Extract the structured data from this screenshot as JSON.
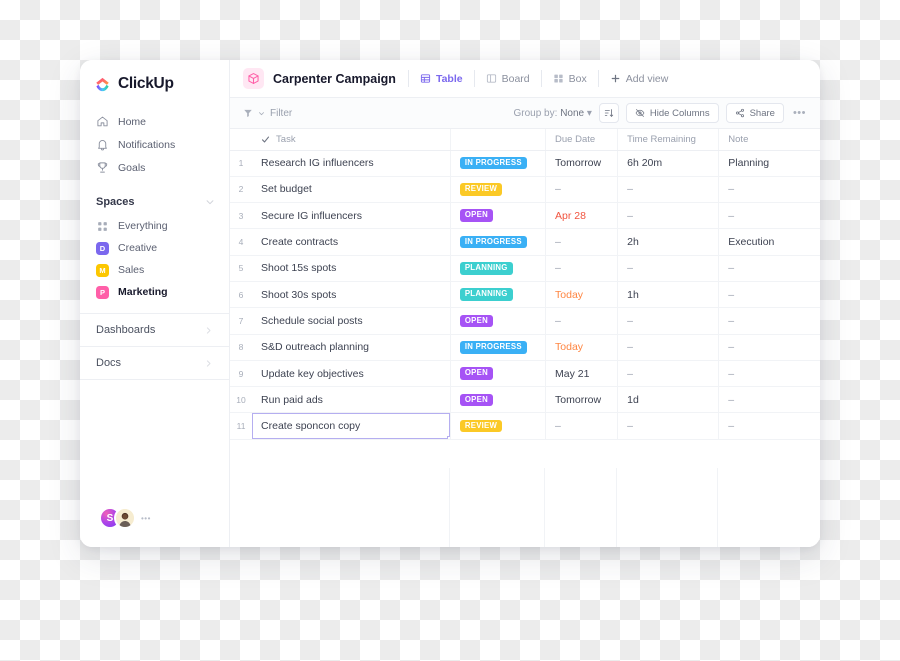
{
  "brand": {
    "name": "ClickUp",
    "logo_icon": "clickup-logo-icon"
  },
  "sidebar": {
    "nav": [
      {
        "label": "Home",
        "icon": "home-icon"
      },
      {
        "label": "Notifications",
        "icon": "bell-icon"
      },
      {
        "label": "Goals",
        "icon": "trophy-icon"
      }
    ],
    "spaces_section": {
      "title": "Spaces",
      "collapse_icon": "chevron-down-icon"
    },
    "spaces": [
      {
        "label": "Everything",
        "icon": "grid-dots-icon",
        "initial": null,
        "color": null,
        "active": false
      },
      {
        "label": "Creative",
        "icon": null,
        "initial": "D",
        "color": "#7b68ee",
        "active": false
      },
      {
        "label": "Sales",
        "icon": null,
        "initial": "M",
        "color": "#fcc700",
        "active": false
      },
      {
        "label": "Marketing",
        "icon": null,
        "initial": "P",
        "color": "#ff5fa8",
        "active": true
      }
    ],
    "footer": [
      {
        "label": "Dashboards",
        "icon": "chevron-right-icon"
      },
      {
        "label": "Docs",
        "icon": "chevron-right-icon"
      }
    ],
    "avatars": [
      {
        "initial": "S",
        "type": "gradient-avatar"
      },
      {
        "initial": "",
        "type": "photo-avatar"
      }
    ],
    "avatar_more": "•••"
  },
  "topbar": {
    "project_icon": "box-cube-icon",
    "project_title": "Carpenter Campaign",
    "views": [
      {
        "label": "Table",
        "icon": "table-grid-icon",
        "active": true
      },
      {
        "label": "Board",
        "icon": "board-columns-icon",
        "active": false
      },
      {
        "label": "Box",
        "icon": "box-blocks-icon",
        "active": false
      }
    ],
    "add_view": {
      "label": "Add view",
      "icon": "plus-icon"
    }
  },
  "toolbar": {
    "filter_label": "Filter",
    "filter_icon": "funnel-icon",
    "group_by_prefix": "Group by:",
    "group_by_value": "None",
    "sort_icon": "sort-icon",
    "hide_columns_label": "Hide Columns",
    "hide_columns_icon": "eye-off-icon",
    "share_label": "Share",
    "share_icon": "share-icon",
    "more_label": "•••"
  },
  "table": {
    "columns": [
      {
        "key": "num",
        "label": ""
      },
      {
        "key": "task",
        "label": "Task",
        "icon": "check-icon"
      },
      {
        "key": "status",
        "label": ""
      },
      {
        "key": "due",
        "label": "Due Date"
      },
      {
        "key": "time",
        "label": "Time Remaining"
      },
      {
        "key": "note",
        "label": "Note"
      }
    ],
    "status_colors": {
      "IN PROGRESS": "#3ab0f5",
      "REVIEW": "#fbc926",
      "OPEN": "#a653f5",
      "PLANNING": "#3ccfcf"
    },
    "rows": [
      {
        "num": "1",
        "task": "Research IG influencers",
        "status": "IN PROGRESS",
        "due": "Tomorrow",
        "due_style": "normal",
        "time": "6h 20m",
        "note": "Planning",
        "selected": false
      },
      {
        "num": "2",
        "task": "Set budget",
        "status": "REVIEW",
        "due": "–",
        "due_style": "normal",
        "time": "–",
        "note": "–",
        "selected": false
      },
      {
        "num": "3",
        "task": "Secure IG influencers",
        "status": "OPEN",
        "due": "Apr 28",
        "due_style": "overdue",
        "time": "–",
        "note": "–",
        "selected": false
      },
      {
        "num": "4",
        "task": "Create contracts",
        "status": "IN PROGRESS",
        "due": "–",
        "due_style": "normal",
        "time": "2h",
        "note": "Execution",
        "selected": false
      },
      {
        "num": "5",
        "task": "Shoot 15s spots",
        "status": "PLANNING",
        "due": "–",
        "due_style": "normal",
        "time": "–",
        "note": "–",
        "selected": false
      },
      {
        "num": "6",
        "task": "Shoot 30s spots",
        "status": "PLANNING",
        "due": "Today",
        "due_style": "urgent",
        "time": "1h",
        "note": "–",
        "selected": false
      },
      {
        "num": "7",
        "task": "Schedule social posts",
        "status": "OPEN",
        "due": "–",
        "due_style": "normal",
        "time": "–",
        "note": "–",
        "selected": false
      },
      {
        "num": "8",
        "task": "S&D outreach planning",
        "status": "IN PROGRESS",
        "due": "Today",
        "due_style": "urgent",
        "time": "–",
        "note": "–",
        "selected": false
      },
      {
        "num": "9",
        "task": "Update key objectives",
        "status": "OPEN",
        "due": "May 21",
        "due_style": "normal",
        "time": "–",
        "note": "–",
        "selected": false
      },
      {
        "num": "10",
        "task": "Run paid ads",
        "status": "OPEN",
        "due": "Tomorrow",
        "due_style": "normal",
        "time": "1d",
        "note": "–",
        "selected": false
      },
      {
        "num": "11",
        "task": "Create sponcon copy",
        "status": "REVIEW",
        "due": "–",
        "due_style": "normal",
        "time": "–",
        "note": "–",
        "selected": true
      }
    ]
  }
}
